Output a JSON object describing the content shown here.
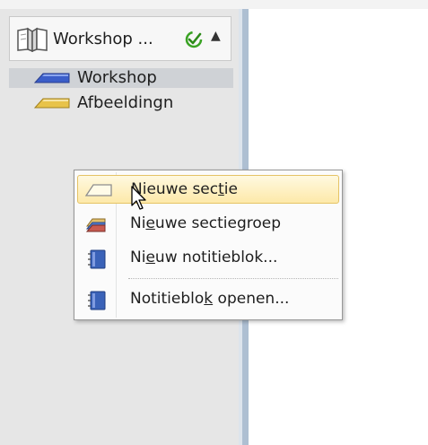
{
  "notebook": {
    "title": "Workshop ...",
    "sections": [
      {
        "label": "Workshop",
        "color": "#3b5ec9",
        "selected": true
      },
      {
        "label": "Afbeeldingn",
        "color": "#e8c34a",
        "selected": false
      }
    ]
  },
  "context_menu": {
    "items": [
      {
        "pre": "Nieuwe sec",
        "key": "t",
        "post": "ie",
        "icon": "new-section-icon",
        "highlighted": true
      },
      {
        "pre": "Ni",
        "key": "e",
        "post": "uwe sectiegroep",
        "icon": "new-section-group-icon"
      },
      {
        "pre": "Ni",
        "key": "e",
        "post": "uw notitieblok...",
        "icon": "new-notebook-icon"
      },
      {
        "pre": "Notitieblo",
        "key": "k",
        "post": " openen...",
        "icon": "open-notebook-icon"
      }
    ]
  },
  "colors": {
    "splitter": "#aebfd2",
    "highlight": "#fde9a9",
    "sync_green": "#3aa324"
  }
}
